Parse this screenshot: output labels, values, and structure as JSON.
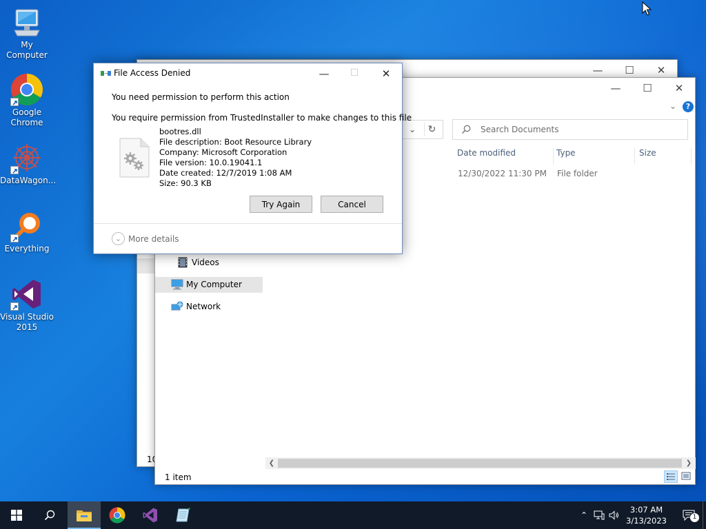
{
  "desktop": {
    "icons": [
      {
        "label": "My Computer",
        "icon": "computer-icon"
      },
      {
        "label": "Google Chrome",
        "icon": "chrome-icon"
      },
      {
        "label": "DataWagon...",
        "icon": "datawagon-icon"
      },
      {
        "label": "Everything",
        "icon": "everything-search-icon"
      },
      {
        "label": "Visual Studio 2015",
        "icon": "visual-studio-icon"
      }
    ]
  },
  "explorer": {
    "search_placeholder": "Search Documents",
    "columns": [
      "Date modified",
      "Type",
      "Size"
    ],
    "rows": [
      {
        "date_modified": "12/30/2022 11:30 PM",
        "type": "File folder",
        "size": ""
      }
    ],
    "nav_items": [
      {
        "label": "Videos",
        "icon": "videos-folder-icon"
      },
      {
        "label": "My Computer",
        "icon": "computer-icon",
        "selected": true
      },
      {
        "label": "Network",
        "icon": "network-icon"
      }
    ],
    "status": "1 item",
    "back_status": "10"
  },
  "dialog": {
    "title": "File Access Denied",
    "heading": "You need permission to perform this action",
    "message": "You require permission from TrustedInstaller to make changes to this file",
    "file": {
      "name": "bootres.dll",
      "description": "File description: Boot Resource Library",
      "company": "Company: Microsoft Corporation",
      "version": "File version: 10.0.19041.1",
      "created": "Date created: 12/7/2019 1:08 AM",
      "size": "Size: 90.3 KB"
    },
    "buttons": {
      "try_again": "Try Again",
      "cancel": "Cancel"
    },
    "more_details": "More details"
  },
  "taskbar": {
    "apps": [
      "file-explorer-icon",
      "chrome-icon",
      "visual-studio-icon",
      "notepad-icon"
    ],
    "time": "3:07 AM",
    "date": "3/13/2023",
    "notification_count": "1"
  },
  "colors": {
    "accent": "#0078d7",
    "selection": "#cce8ff",
    "taskbar": "#101a29"
  }
}
